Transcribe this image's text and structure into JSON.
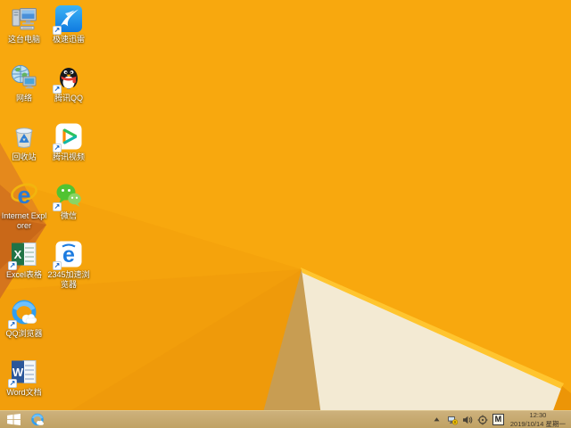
{
  "wallpaper": {
    "colors": {
      "base": "#F8A80E",
      "wedge1": "#F5A30C",
      "wedge2": "#F29E0B",
      "wedge3": "#EF9A0A",
      "fold1": "#E5891C",
      "fold2": "#D5751D",
      "fold3": "#C96818",
      "tan": "#C89D52",
      "cream": "#F3EAD3",
      "highlight": "#FFC52F",
      "corner": "#EC9507"
    }
  },
  "desktop": {
    "icons": [
      {
        "name": "this-pc",
        "label": "这台电脑",
        "type": "this-pc",
        "brand": "#4a90d9",
        "row": 0,
        "col": 0,
        "shortcut": false
      },
      {
        "name": "xunlei",
        "label": "极速迅雷",
        "type": "xunlei",
        "brand": "#0f7ae0",
        "row": 0,
        "col": 1,
        "shortcut": true
      },
      {
        "name": "network",
        "label": "网络",
        "type": "network",
        "brand": "#4aa3d8",
        "row": 1,
        "col": 0,
        "shortcut": false
      },
      {
        "name": "tencent-qq",
        "label": "腾讯QQ",
        "type": "qq",
        "brand": "#15181d",
        "row": 1,
        "col": 1,
        "shortcut": true
      },
      {
        "name": "recycle-bin",
        "label": "回收站",
        "type": "recycle",
        "brand": "#2f7fd6",
        "row": 2,
        "col": 0,
        "shortcut": false
      },
      {
        "name": "tencent-video",
        "label": "腾讯视频",
        "type": "tvideo",
        "brand": "#12b7a6",
        "row": 2,
        "col": 1,
        "shortcut": true
      },
      {
        "name": "internet-explorer",
        "label": "Internet Explorer",
        "type": "ie",
        "brand": "#2a7ad4",
        "glyph": "e",
        "row": 3,
        "col": 0,
        "shortcut": false
      },
      {
        "name": "wechat",
        "label": "微信",
        "type": "wechat",
        "brand": "#51c332",
        "row": 3,
        "col": 1,
        "shortcut": true
      },
      {
        "name": "excel",
        "label": "Excel表格",
        "type": "office",
        "brand": "#217346",
        "glyph": "X",
        "row": 4,
        "col": 0,
        "shortcut": true
      },
      {
        "name": "browser-2345",
        "label": "2345加速浏览器",
        "type": "e2345",
        "brand": "#1c7be0",
        "glyph": "e",
        "row": 4,
        "col": 1,
        "shortcut": true
      },
      {
        "name": "qq-browser",
        "label": "QQ浏览器",
        "type": "qqbrowser",
        "brand": "#2f9ef0",
        "row": 5,
        "col": 0,
        "shortcut": true
      },
      {
        "name": "word",
        "label": "Word文档",
        "type": "office",
        "brand": "#2b579a",
        "glyph": "W",
        "row": 6,
        "col": 0,
        "shortcut": true
      }
    ]
  },
  "taskbar": {
    "start_button": {
      "name": "start-button"
    },
    "pinned": [
      {
        "name": "qq-browser-taskbar"
      }
    ],
    "tray": {
      "icons": [
        {
          "name": "hidden-icons-chevron",
          "type": "chevron"
        },
        {
          "name": "network-status",
          "type": "network"
        },
        {
          "name": "volume",
          "type": "volume"
        },
        {
          "name": "safety-target",
          "type": "target"
        }
      ],
      "input_indicator": "M"
    },
    "clock": {
      "time": "12:30",
      "date": "2019/10/14",
      "weekday": "星期一"
    }
  }
}
